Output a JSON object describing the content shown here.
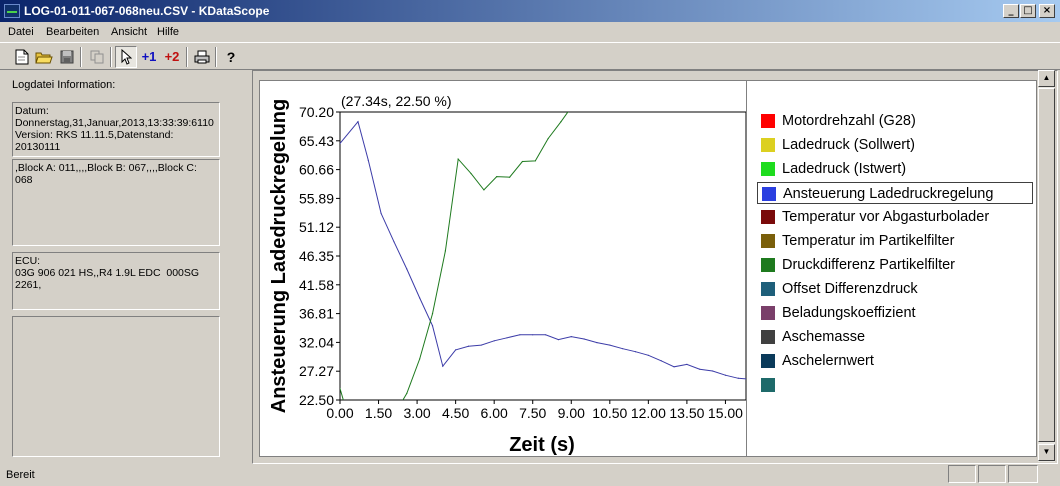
{
  "window": {
    "title": "LOG-01-011-067-068neu.CSV - KDataScope",
    "buttons": [
      "_",
      "□",
      "×"
    ]
  },
  "menu": [
    "Datei",
    "Bearbeiten",
    "Ansicht",
    "Hilfe"
  ],
  "toolbar": {
    "icons": [
      "new-file-icon",
      "open-folder-icon",
      "save-icon",
      "copy-icon",
      "pointer-icon",
      "cursor-1-icon",
      "cursor-2-icon",
      "print-icon",
      "help-icon"
    ],
    "labels": {
      "cursor1": "+1",
      "cursor2": "+2",
      "help": "?"
    }
  },
  "left_panel": {
    "header": "Logdatei Information:",
    "boxes": [
      "Datum:\nDonnerstag,31,Januar,2013,13:33:39:6110\nVersion: RKS 11.11.5,Datenstand:\n20130111",
      ",Block A: 011,,,,Block B: 067,,,,Block C:\n068",
      "ECU:\n03G 906 021 HS,,R4 1.9L EDC  000SG\n2261,",
      ""
    ]
  },
  "status": "Bereit",
  "colors": {
    "blue_line": "#3c3ca8",
    "green_line": "#1e7a1e",
    "title_bar_start": "#0a246a",
    "title_bar_end": "#a6caf0"
  },
  "chart_data": {
    "type": "line",
    "cursor_readout": "(27.34s, 22.50 %)",
    "xlabel": "Zeit (s)",
    "ylabel": "Ansteuerung Ladedruckregelung",
    "x_ticks": [
      "0.00",
      "1.50",
      "3.00",
      "4.50",
      "6.00",
      "7.50",
      "9.00",
      "10.50",
      "12.00",
      "13.50",
      "15.00"
    ],
    "y_ticks": [
      "70.20",
      "65.43",
      "60.66",
      "55.89",
      "51.12",
      "46.35",
      "41.58",
      "36.81",
      "32.04",
      "27.27",
      "22.50"
    ],
    "xlim": [
      0,
      15.8
    ],
    "ylim": [
      22.5,
      70.2
    ],
    "grid": false,
    "series": [
      {
        "name": "Ansteuerung Ladedruckregelung",
        "color": "#3c3ca8",
        "x": [
          0,
          0.7,
          1.1,
          1.6,
          2.1,
          2.6,
          3.1,
          3.6,
          4.0,
          4.5,
          5.0,
          5.5,
          6.0,
          6.5,
          7.0,
          7.5,
          8.0,
          8.5,
          9.0,
          9.5,
          10.0,
          10.5,
          11.0,
          11.5,
          12.0,
          12.5,
          13.0,
          13.5,
          14.0,
          14.5,
          15.0,
          15.5,
          15.8
        ],
        "y": [
          65.0,
          68.6,
          62.2,
          53.4,
          48.7,
          44.2,
          39.4,
          34.8,
          28.1,
          30.8,
          31.4,
          31.6,
          32.3,
          32.8,
          33.3,
          33.3,
          33.3,
          32.5,
          33.0,
          32.6,
          32.0,
          31.6,
          31.0,
          30.5,
          29.9,
          29.0,
          28.0,
          28.4,
          27.6,
          27.3,
          26.6,
          26.1,
          26.0
        ]
      },
      {
        "name": "Druckdifferenz Partikelfilter",
        "color": "#1e7a1e",
        "x": [
          0,
          0.3,
          2.1,
          2.6,
          3.1,
          3.6,
          4.1,
          4.6,
          5.1,
          5.6,
          6.1,
          6.6,
          7.1,
          7.6,
          8.1,
          8.6,
          9.0
        ],
        "y": [
          24.4,
          20.0,
          20.0,
          23.6,
          29.3,
          36.8,
          47.2,
          62.4,
          60.0,
          57.3,
          59.5,
          59.4,
          62.0,
          62.1,
          65.8,
          68.6,
          71.0
        ]
      }
    ],
    "legend": [
      {
        "name": "Motordrehzahl (G28)",
        "color": "#ff0000"
      },
      {
        "name": "Ladedruck (Sollwert)",
        "color": "#dcd020"
      },
      {
        "name": "Ladedruck (Istwert)",
        "color": "#1edc1e"
      },
      {
        "name": "Ansteuerung Ladedruckregelung",
        "color": "#2a3fe0",
        "selected": true
      },
      {
        "name": "Temperatur vor Abgasturbolader",
        "color": "#7a0a0a"
      },
      {
        "name": "Temperatur im Partikelfilter",
        "color": "#7a5f0a"
      },
      {
        "name": "Druckdifferenz Partikelfilter",
        "color": "#1e7a1e"
      },
      {
        "name": "Offset Differenzdruck",
        "color": "#1e5f7a"
      },
      {
        "name": "Beladungskoeffizient",
        "color": "#7a3f6a"
      },
      {
        "name": "Aschemasse",
        "color": "#404040"
      },
      {
        "name": "Aschelernwert",
        "color": "#0a3a5a"
      },
      {
        "name": "",
        "color": "#1e6a6a"
      }
    ],
    "legend_position": "right"
  }
}
